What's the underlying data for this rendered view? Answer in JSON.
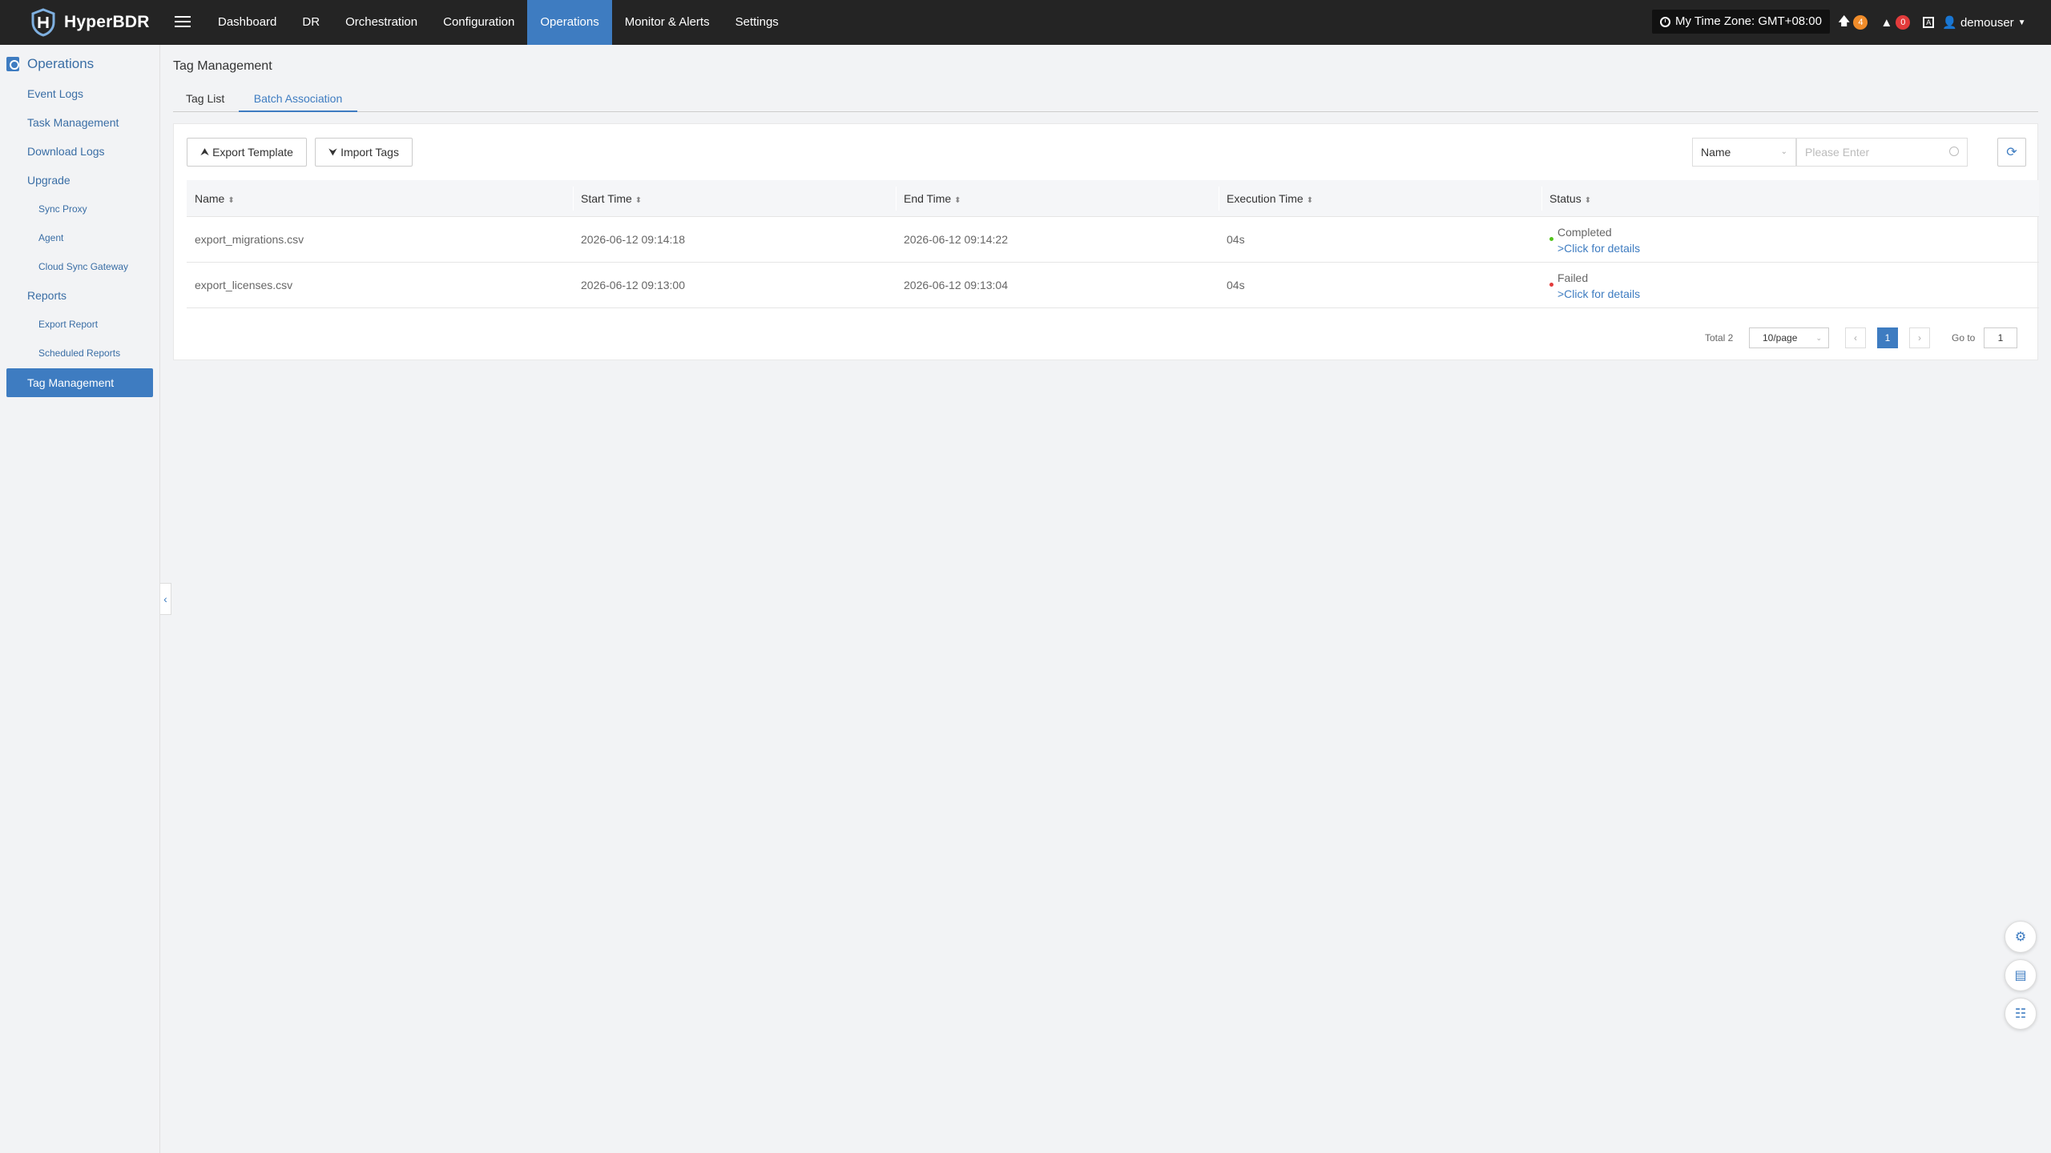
{
  "app": {
    "name": "HyperBDR"
  },
  "nav": {
    "items": [
      "Dashboard",
      "DR",
      "Orchestration",
      "Configuration",
      "Operations",
      "Monitor & Alerts",
      "Settings"
    ],
    "active": "Operations"
  },
  "header": {
    "timezone": "My Time Zone: GMT+08:00",
    "upgrade_count": "4",
    "alert_count": "0",
    "user": "demouser"
  },
  "sidebar": {
    "section": "Operations",
    "items": {
      "event_logs": "Event Logs",
      "task_management": "Task Management",
      "download_logs": "Download Logs",
      "upgrade": "Upgrade",
      "sync_proxy": "Sync Proxy",
      "agent": "Agent",
      "cloud_sync_gateway": "Cloud Sync Gateway",
      "reports": "Reports",
      "export_report": "Export Report",
      "scheduled_reports": "Scheduled Reports",
      "tag_management": "Tag Management"
    }
  },
  "page": {
    "title": "Tag Management",
    "tabs": [
      "Tag List",
      "Batch Association"
    ],
    "active_tab": "Batch Association"
  },
  "toolbar": {
    "export_template": "Export Template",
    "import_tags": "Import Tags",
    "filter_field": "Name",
    "search_placeholder": "Please Enter"
  },
  "table": {
    "columns": [
      "Name",
      "Start Time",
      "End Time",
      "Execution Time",
      "Status"
    ],
    "rows": [
      {
        "name": "export_migrations.csv",
        "start": "2026-06-12 09:14:18",
        "end": "2026-06-12 09:14:22",
        "exec": "04s",
        "status": "Completed",
        "status_color": "#52c41a",
        "details": ">Click for details"
      },
      {
        "name": "export_licenses.csv",
        "start": "2026-06-12 09:13:00",
        "end": "2026-06-12 09:13:04",
        "exec": "04s",
        "status": "Failed",
        "status_color": "#e23b3b",
        "details": ">Click for details"
      }
    ]
  },
  "pagination": {
    "total": "Total 2",
    "page_size": "10/page",
    "current_page": "1",
    "goto_label": "Go to",
    "goto_value": "1"
  },
  "colors": {
    "accent": "#3e7cc1",
    "topbar": "#242424",
    "success": "#52c41a",
    "danger": "#e23b3b",
    "warning": "#f08c2a"
  }
}
